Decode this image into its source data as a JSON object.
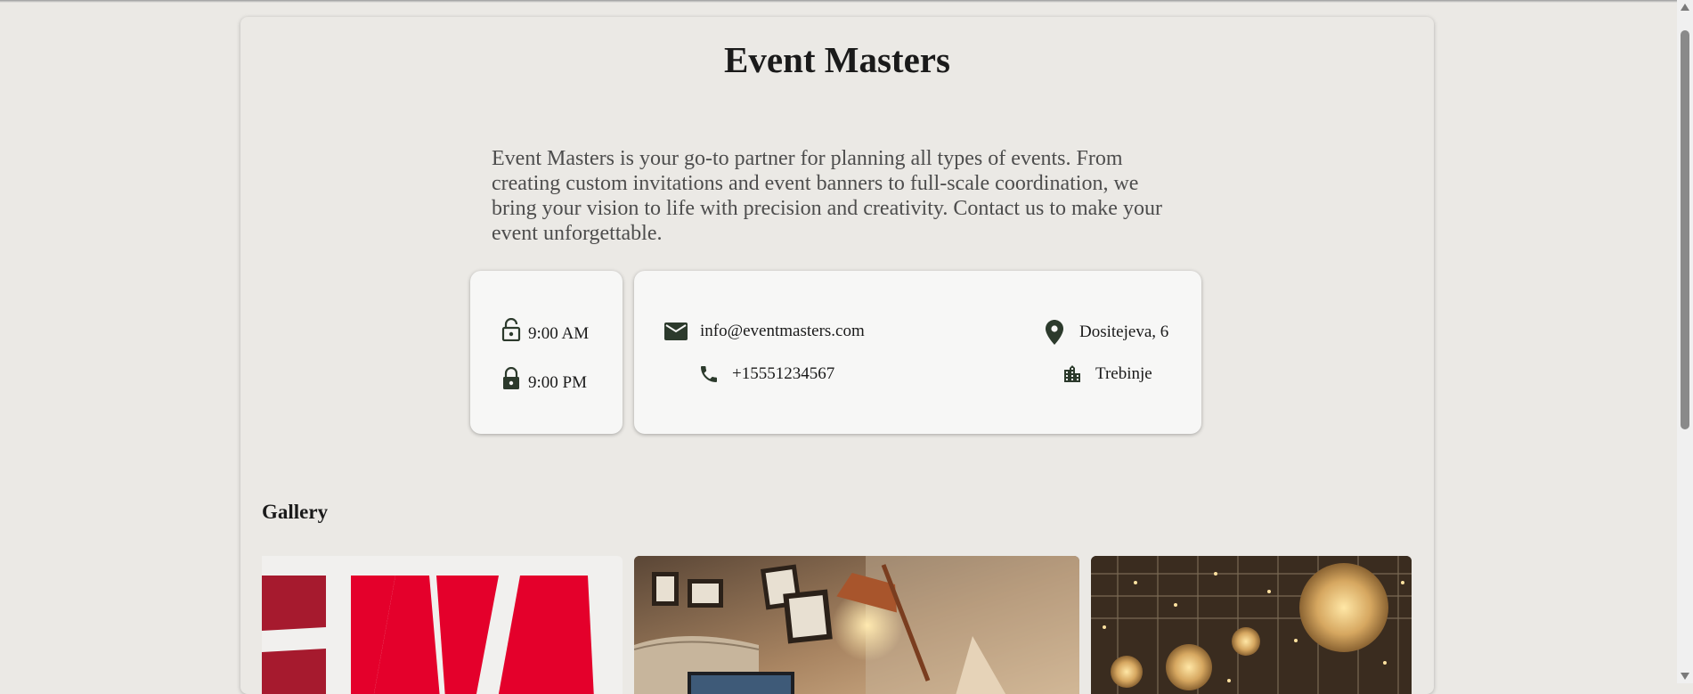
{
  "page": {
    "title": "Event Masters",
    "description": "Event Masters is your go-to partner for planning all types of events. From creating custom invitations and event banners to full-scale coordination, we bring your vision to life with precision and creativity. Contact us to make your event unforgettable."
  },
  "hours": {
    "open": {
      "icon": "lock-open-icon",
      "time": "9:00 AM"
    },
    "close": {
      "icon": "lock-icon",
      "time": "9:00 PM"
    }
  },
  "contact": {
    "email": {
      "icon": "email-icon",
      "value": "info@eventmasters.com"
    },
    "phone": {
      "icon": "phone-icon",
      "value": "+15551234567"
    },
    "address": {
      "icon": "location-pin-icon",
      "value": "Dositejeva, 6"
    },
    "city": {
      "icon": "city-building-icon",
      "value": "Trebinje"
    }
  },
  "gallery": {
    "heading": "Gallery"
  },
  "theme": {
    "background": "#ebe9e5",
    "box_background": "#f7f7f6",
    "icon_color": "#2c3a2c",
    "logo_red": "#e4002b"
  }
}
